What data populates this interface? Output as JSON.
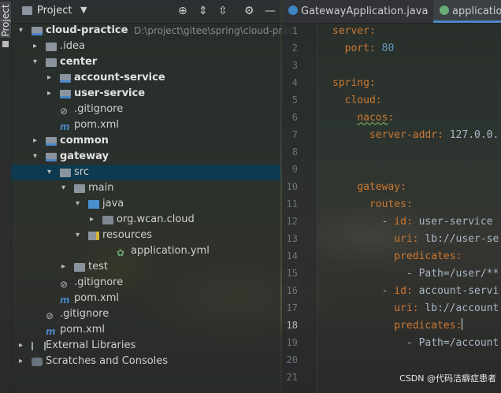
{
  "side_tab": {
    "label": "Project"
  },
  "project_panel": {
    "title": "Project",
    "tree": [
      {
        "label": "cloud-practice",
        "path": "D:\\project\\gitee\\spring\\cloud-pract",
        "arrow": "⌄",
        "icon": "module",
        "bold": true,
        "indent": 0
      },
      {
        "label": ".idea",
        "arrow": "›",
        "icon": "folder",
        "indent": 1
      },
      {
        "label": "center",
        "arrow": "⌄",
        "icon": "folder",
        "bold": true,
        "indent": 1
      },
      {
        "label": "account-service",
        "arrow": "›",
        "icon": "module",
        "bold": true,
        "indent": 2
      },
      {
        "label": "user-service",
        "arrow": "›",
        "icon": "module",
        "bold": true,
        "indent": 2
      },
      {
        "label": ".gitignore",
        "icon": "gitignore",
        "indent": 2
      },
      {
        "label": "pom.xml",
        "icon": "maven",
        "indent": 2
      },
      {
        "label": "common",
        "arrow": "›",
        "icon": "module",
        "bold": true,
        "indent": 1
      },
      {
        "label": "gateway",
        "arrow": "⌄",
        "icon": "module",
        "bold": true,
        "indent": 1
      },
      {
        "label": "src",
        "arrow": "⌄",
        "icon": "folder",
        "indent": 2,
        "selected": true
      },
      {
        "label": "main",
        "arrow": "⌄",
        "icon": "folder",
        "indent": 3
      },
      {
        "label": "java",
        "arrow": "⌄",
        "icon": "source-folder",
        "indent": 4
      },
      {
        "label": "org.wcan.cloud",
        "arrow": "›",
        "icon": "package",
        "indent": 5
      },
      {
        "label": "resources",
        "arrow": "⌄",
        "icon": "resources",
        "indent": 4
      },
      {
        "label": "application.yml",
        "icon": "yaml",
        "indent": 6
      },
      {
        "label": "test",
        "arrow": "›",
        "icon": "folder",
        "indent": 3
      },
      {
        "label": ".gitignore",
        "icon": "gitignore",
        "indent": 2
      },
      {
        "label": "pom.xml",
        "icon": "maven",
        "indent": 2
      },
      {
        "label": ".gitignore",
        "icon": "gitignore",
        "indent": 1
      },
      {
        "label": "pom.xml",
        "icon": "maven",
        "indent": 1
      },
      {
        "label": "External Libraries",
        "arrow": "›",
        "icon": "libraries",
        "indent": 0
      },
      {
        "label": "Scratches and Consoles",
        "arrow": "›",
        "icon": "scratches",
        "indent": 0
      }
    ]
  },
  "editor": {
    "tabs": [
      {
        "label": "GatewayApplication.java",
        "icon": "class-icon",
        "active": false,
        "close": "×"
      },
      {
        "label": "application",
        "icon": "yaml-icon",
        "active": true
      }
    ],
    "line_numbers": [
      "1",
      "2",
      "3",
      "4",
      "5",
      "6",
      "7",
      "8",
      "9",
      "10",
      "11",
      "12",
      "13",
      "14",
      "15",
      "16",
      "17",
      "18",
      "19",
      "20",
      "21"
    ],
    "current_line": "18",
    "lines": [
      {
        "indent": "",
        "key": "server",
        "sep": ":",
        "val": ""
      },
      {
        "indent": "  ",
        "key": "port",
        "sep": ": ",
        "val": "80",
        "numeric": true
      },
      {
        "indent": "",
        "key": "",
        "sep": "",
        "val": ""
      },
      {
        "indent": "",
        "key": "spring",
        "sep": ":",
        "val": ""
      },
      {
        "indent": "  ",
        "key": "cloud",
        "sep": ":",
        "val": ""
      },
      {
        "indent": "    ",
        "key": "nacos",
        "sep": ":",
        "val": "",
        "squiggle": true
      },
      {
        "indent": "      ",
        "key": "server-addr",
        "sep": ": ",
        "val": "127.0.0."
      },
      {
        "indent": "",
        "key": "",
        "sep": "",
        "val": ""
      },
      {
        "indent": "",
        "key": "",
        "sep": "",
        "val": ""
      },
      {
        "indent": "    ",
        "key": "gateway",
        "sep": ":",
        "val": ""
      },
      {
        "indent": "      ",
        "key": "routes",
        "sep": ":",
        "val": ""
      },
      {
        "indent": "        - ",
        "key": "id",
        "sep": ": ",
        "val": "user-service"
      },
      {
        "indent": "          ",
        "key": "uri",
        "sep": ": ",
        "val": "lb://user-se"
      },
      {
        "indent": "          ",
        "key": "predicates",
        "sep": ":",
        "val": ""
      },
      {
        "indent": "            ",
        "key": "",
        "sep": "",
        "val": "- Path=/user/**"
      },
      {
        "indent": "        - ",
        "key": "id",
        "sep": ": ",
        "val": "account-servi"
      },
      {
        "indent": "          ",
        "key": "uri",
        "sep": ": ",
        "val": "lb://account"
      },
      {
        "indent": "          ",
        "key": "predicates",
        "sep": ":",
        "val": "",
        "caret": true
      },
      {
        "indent": "            ",
        "key": "",
        "sep": "",
        "val": "- Path=/account"
      },
      {
        "indent": "",
        "key": "",
        "sep": "",
        "val": ""
      },
      {
        "indent": "",
        "key": "",
        "sep": "",
        "val": ""
      }
    ]
  },
  "watermark": "CSDN @代码洁癖症患者",
  "colors": {
    "selection": "#0d3a4e",
    "keyword": "#cc7832",
    "number": "#6897bb",
    "tab_underline": "#4a88c7"
  }
}
